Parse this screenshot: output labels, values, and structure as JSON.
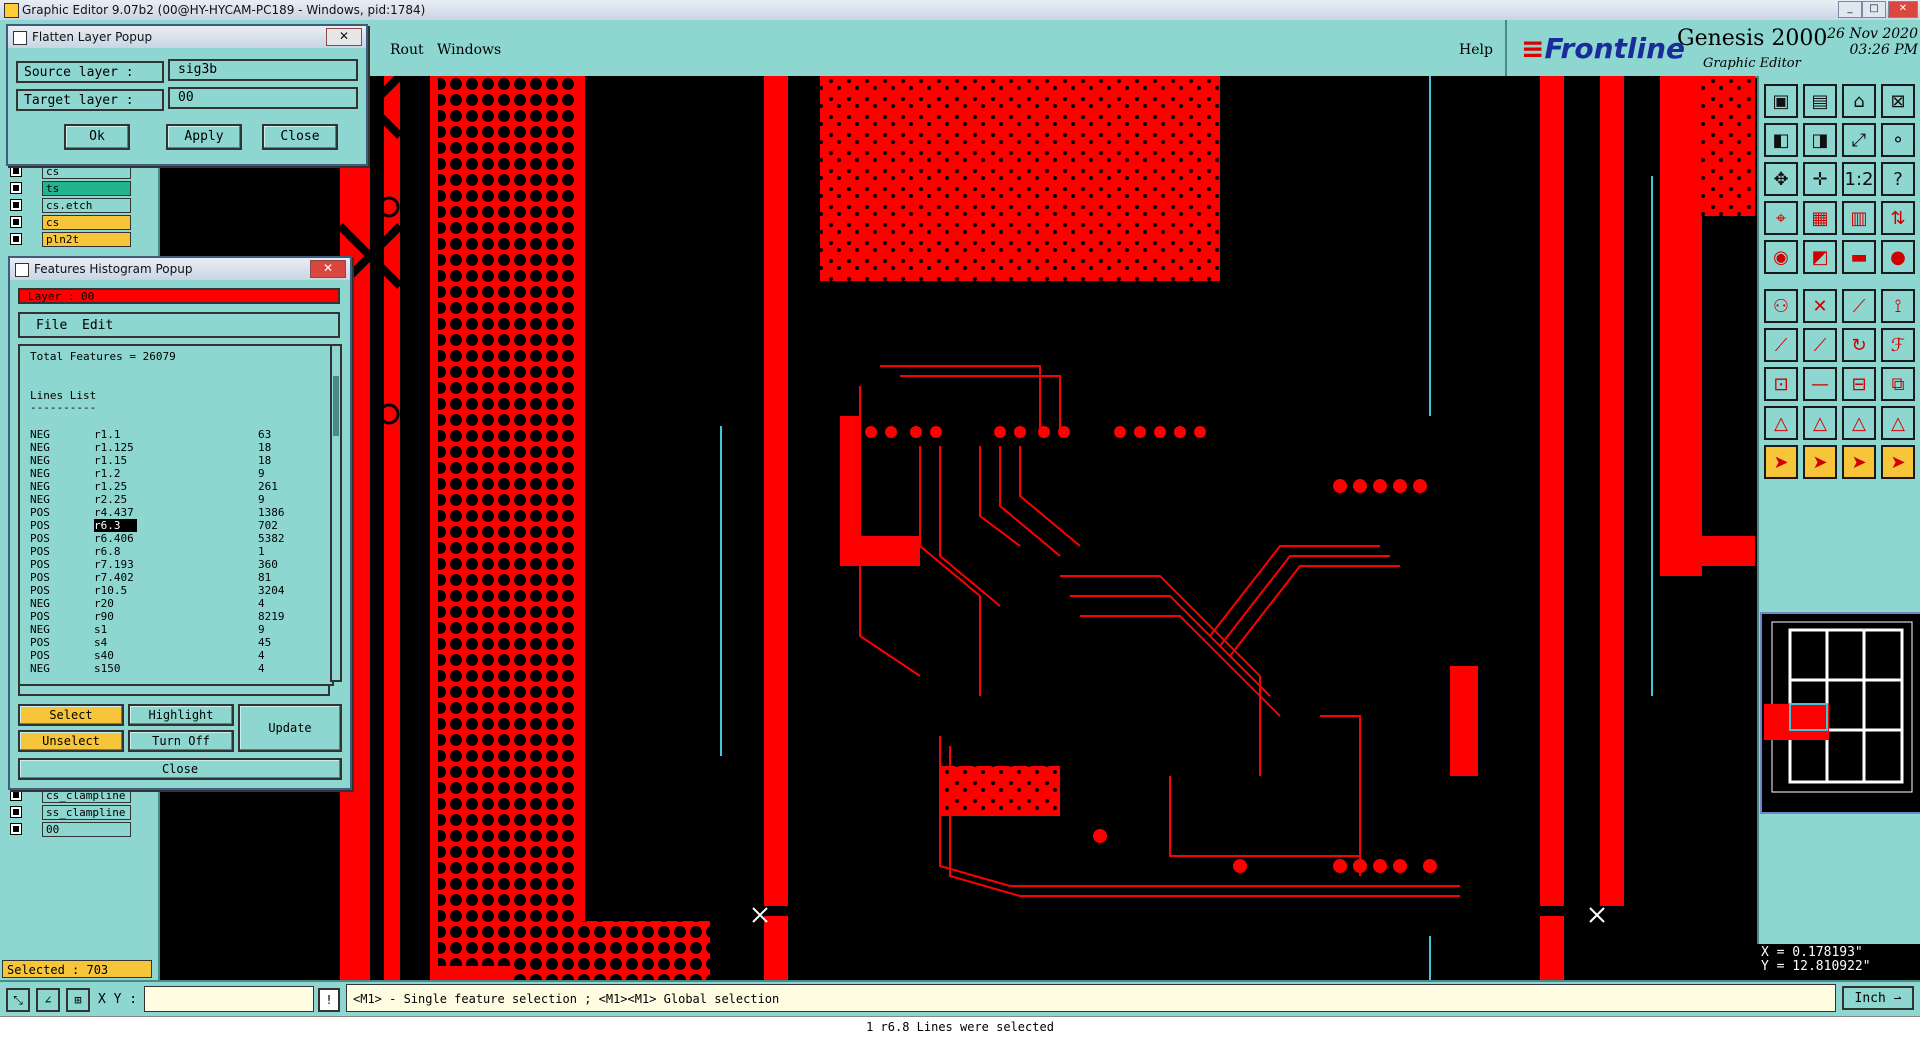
{
  "window": {
    "title": "Graphic Editor 9.07b2 (00@HY-HYCAM-PC189 - Windows, pid:1784)",
    "controls": [
      "_",
      "□",
      "✕"
    ]
  },
  "menubar": {
    "items": [
      "Rout",
      "Windows"
    ],
    "help": "Help"
  },
  "brand": {
    "logo": "Frontline",
    "product": "Genesis 2000",
    "subtitle": "Graphic Editor",
    "date": "26 Nov 2020",
    "time": "03:26 PM"
  },
  "flatten_popup": {
    "title": "Flatten Layer Popup",
    "source_label": "Source layer :",
    "source_value": "sig3b",
    "target_label": "Target layer :",
    "target_value": "00",
    "ok": "Ok",
    "apply": "Apply",
    "close": "Close"
  },
  "histogram_popup": {
    "title": "Features Histogram Popup",
    "layer_label": "Layer :  00",
    "menu": [
      "File",
      "Edit"
    ],
    "total": "Total Features = 26079",
    "section": "Lines List",
    "underline": "----------",
    "rows": [
      [
        "NEG",
        "r1.1",
        "63"
      ],
      [
        "NEG",
        "r1.125",
        "18"
      ],
      [
        "NEG",
        "r1.15",
        "18"
      ],
      [
        "NEG",
        "r1.2",
        "9"
      ],
      [
        "NEG",
        "r1.25",
        "261"
      ],
      [
        "NEG",
        "r2.25",
        "9"
      ],
      [
        "POS",
        "r4.437",
        "1386"
      ],
      [
        "POS",
        "r6.3",
        "702"
      ],
      [
        "POS",
        "r6.406",
        "5382"
      ],
      [
        "POS",
        "r6.8",
        "1"
      ],
      [
        "POS",
        "r7.193",
        "360"
      ],
      [
        "POS",
        "r7.402",
        "81"
      ],
      [
        "POS",
        "r10.5",
        "3204"
      ],
      [
        "NEG",
        "r20",
        "4"
      ],
      [
        "POS",
        "r90",
        "8219"
      ],
      [
        "NEG",
        "s1",
        "9"
      ],
      [
        "POS",
        "s4",
        "45"
      ],
      [
        "POS",
        "s40",
        "4"
      ],
      [
        "NEG",
        "s150",
        "4"
      ]
    ],
    "selected_row": 7,
    "buttons": {
      "select": "Select",
      "highlight": "Highlight",
      "update": "Update",
      "unselect": "Unselect",
      "turn_off": "Turn Off",
      "close": "Close"
    }
  },
  "layers": {
    "top": [
      {
        "name": "cs",
        "color": "#8ed6d0"
      },
      {
        "name": "ts",
        "color": "#24b38f"
      },
      {
        "name": "cs.etch",
        "color": "#8ed6d0"
      },
      {
        "name": "cs",
        "color": "#f7c53a"
      },
      {
        "name": "pln2t",
        "color": "#f7c53a"
      }
    ],
    "bottom": [
      {
        "name": "cs_clampline",
        "color": "#8ed6d0"
      },
      {
        "name": "ss_clampline",
        "color": "#8ed6d0"
      },
      {
        "name": "00",
        "color": "#8ed6d0"
      }
    ]
  },
  "status": {
    "selected": "Selected : 703",
    "xy_label": "X Y :",
    "prompt": "<M1> - Single feature selection ; <M1><M1> Global selection",
    "units": "Inch",
    "message": "1 r6.8 Lines were selected",
    "x": "X = 0.178193\"",
    "y": "Y = 12.810922\""
  },
  "colors": {
    "panel": "#8ed6d0",
    "feature_red": "#ff0000",
    "highlight_yellow": "#f7c53a",
    "frontline_blue": "#1a2b9a"
  },
  "toolbox": {
    "tools": [
      "open-step-icon",
      "save-icon",
      "home-icon",
      "zoom-home-icon",
      "pan-left-icon",
      "pan-right-icon",
      "zoom-fit-icon",
      "zoom-select-icon",
      "move-icon",
      "center-icon",
      "ratio-icon",
      "help-icon",
      "measure-icon",
      "grid-icon",
      "layers-icon",
      "snap-icon",
      "pad-icon",
      "line-icon",
      "ruler-icon",
      "circle-icon",
      "net-icon",
      "cross-icon",
      "connect-icon",
      "arc-point-icon",
      "slash-icon",
      "slash-red-icon",
      "rotate-icon",
      "text-icon",
      "drill-icon",
      "minus-icon",
      "panel-icon",
      "copy-icon",
      "poly-icon",
      "poly2-icon",
      "poly3-icon",
      "poly4-icon",
      "pointer-icon",
      "pointer2-icon",
      "pointer3-icon",
      "pointer4-icon"
    ]
  }
}
